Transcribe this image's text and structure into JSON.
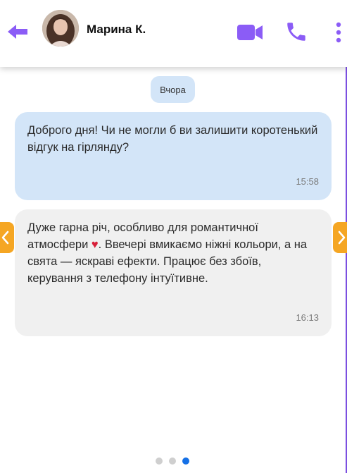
{
  "header": {
    "contact_name": "Марина К."
  },
  "chat": {
    "date_divider": "Вчора",
    "messages": [
      {
        "direction": "outgoing",
        "text": "Доброго дня! Чи не могли б ви залишити коротенький відгук на гірлянду?",
        "time": "15:58"
      },
      {
        "direction": "incoming",
        "text_before_emoji": "Дуже гарна річ, особливо для романтичної атмосфери ",
        "emoji": "♥",
        "text_after_emoji": ". Ввечері вмикаємо ніжні кольори, а на свята — яскраві ефекти. Працює без збоїв, керування з телефону інтуїтивне.",
        "time": "16:13"
      }
    ]
  },
  "pagination": {
    "total": 3,
    "active_index": 2
  },
  "colors": {
    "accent_purple": "#8b5cf6",
    "outgoing_bubble": "#d3e5f8",
    "incoming_bubble": "#f0f0f0",
    "nav_arrow": "#f5a623",
    "active_dot": "#1570e6",
    "heart": "#d8203a"
  }
}
